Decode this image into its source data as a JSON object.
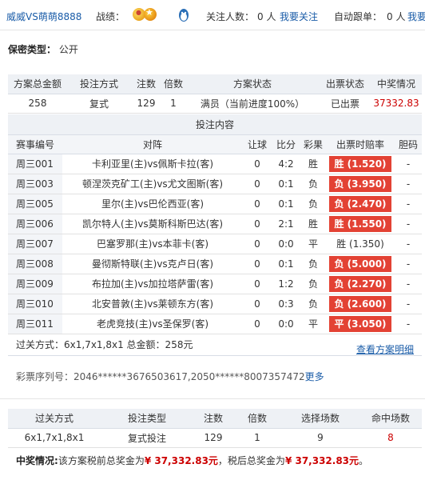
{
  "topbar": {
    "username": "威威VS萌萌8888",
    "record_label": "战绩：",
    "follow_label": "关注人数：",
    "follow_count": "0 人",
    "follow_link": "我要关注",
    "auto_label": "自动跟单：",
    "auto_count": "0 人",
    "auto_link": "我要"
  },
  "secret": {
    "label": "保密类型：",
    "value": "公开"
  },
  "plan": {
    "headers": [
      "方案总金额",
      "投注方式",
      "注数",
      "倍数",
      "方案状态",
      "出票状态",
      "中奖情况"
    ],
    "row": [
      "258",
      "复式",
      "129",
      "1",
      "满员（当前进度100%）",
      "已出票",
      "37332.83"
    ]
  },
  "bets": {
    "title": "投注内容",
    "headers": [
      "赛事编号",
      "对阵",
      "让球",
      "比分",
      "彩果",
      "出票时赔率",
      "胆码"
    ],
    "matches": [
      {
        "code": "周三001",
        "match": "卡利亚里(主)vs佩斯卡拉(客)",
        "handicap": "0",
        "score": "4:2",
        "result": "胜",
        "odds": "胜 (1.520)",
        "hit": true,
        "banker": "-"
      },
      {
        "code": "周三003",
        "match": "顿涅茨克矿工(主)vs尤文图斯(客)",
        "handicap": "0",
        "score": "0:1",
        "result": "负",
        "odds": "负 (3.950)",
        "hit": true,
        "banker": "-"
      },
      {
        "code": "周三005",
        "match": "里尔(主)vs巴伦西亚(客)",
        "handicap": "0",
        "score": "0:1",
        "result": "负",
        "odds": "负 (2.470)",
        "hit": true,
        "banker": "-"
      },
      {
        "code": "周三006",
        "match": "凯尔特人(主)vs莫斯科斯巴达(客)",
        "handicap": "0",
        "score": "2:1",
        "result": "胜",
        "odds": "胜 (1.550)",
        "hit": true,
        "banker": "-"
      },
      {
        "code": "周三007",
        "match": "巴塞罗那(主)vs本菲卡(客)",
        "handicap": "0",
        "score": "0:0",
        "result": "平",
        "odds": "胜 (1.350)",
        "hit": false,
        "banker": "-"
      },
      {
        "code": "周三008",
        "match": "曼彻斯特联(主)vs克卢日(客)",
        "handicap": "0",
        "score": "0:1",
        "result": "负",
        "odds": "负 (5.000)",
        "hit": true,
        "banker": "-"
      },
      {
        "code": "周三009",
        "match": "布拉加(主)vs加拉塔萨雷(客)",
        "handicap": "0",
        "score": "1:2",
        "result": "负",
        "odds": "负 (2.270)",
        "hit": true,
        "banker": "-"
      },
      {
        "code": "周三010",
        "match": "北安普敦(主)vs莱顿东方(客)",
        "handicap": "0",
        "score": "0:3",
        "result": "负",
        "odds": "负 (2.600)",
        "hit": true,
        "banker": "-"
      },
      {
        "code": "周三011",
        "match": "老虎竞技(主)vs圣保罗(客)",
        "handicap": "0",
        "score": "0:0",
        "result": "平",
        "odds": "平 (3.050)",
        "hit": true,
        "banker": "-"
      }
    ],
    "footer": "过关方式：6x1,7x1,8x1 总金额：258元",
    "detail_link": "查看方案明细"
  },
  "serial": {
    "label": "彩票序列号：",
    "value": "2046******3676503617,2050******8007357472",
    "more": "更多"
  },
  "summary": {
    "headers": [
      "过关方式",
      "投注类型",
      "注数",
      "倍数",
      "选择场数",
      "命中场数"
    ],
    "row": [
      "6x1,7x1,8x1",
      "复式投注",
      "129",
      "1",
      "9",
      "8"
    ]
  },
  "prize": {
    "label": "中奖情况:",
    "text1": "该方案税前总奖金为",
    "pre_tax": "¥ 37,332.83元",
    "text2": "，税后总奖金为",
    "post_tax": "¥ 37,332.83元",
    "text3": "。"
  },
  "colors": {
    "accent_red": "#e34234",
    "link_blue": "#1a5ca8",
    "header_bg": "#eef1f5"
  }
}
